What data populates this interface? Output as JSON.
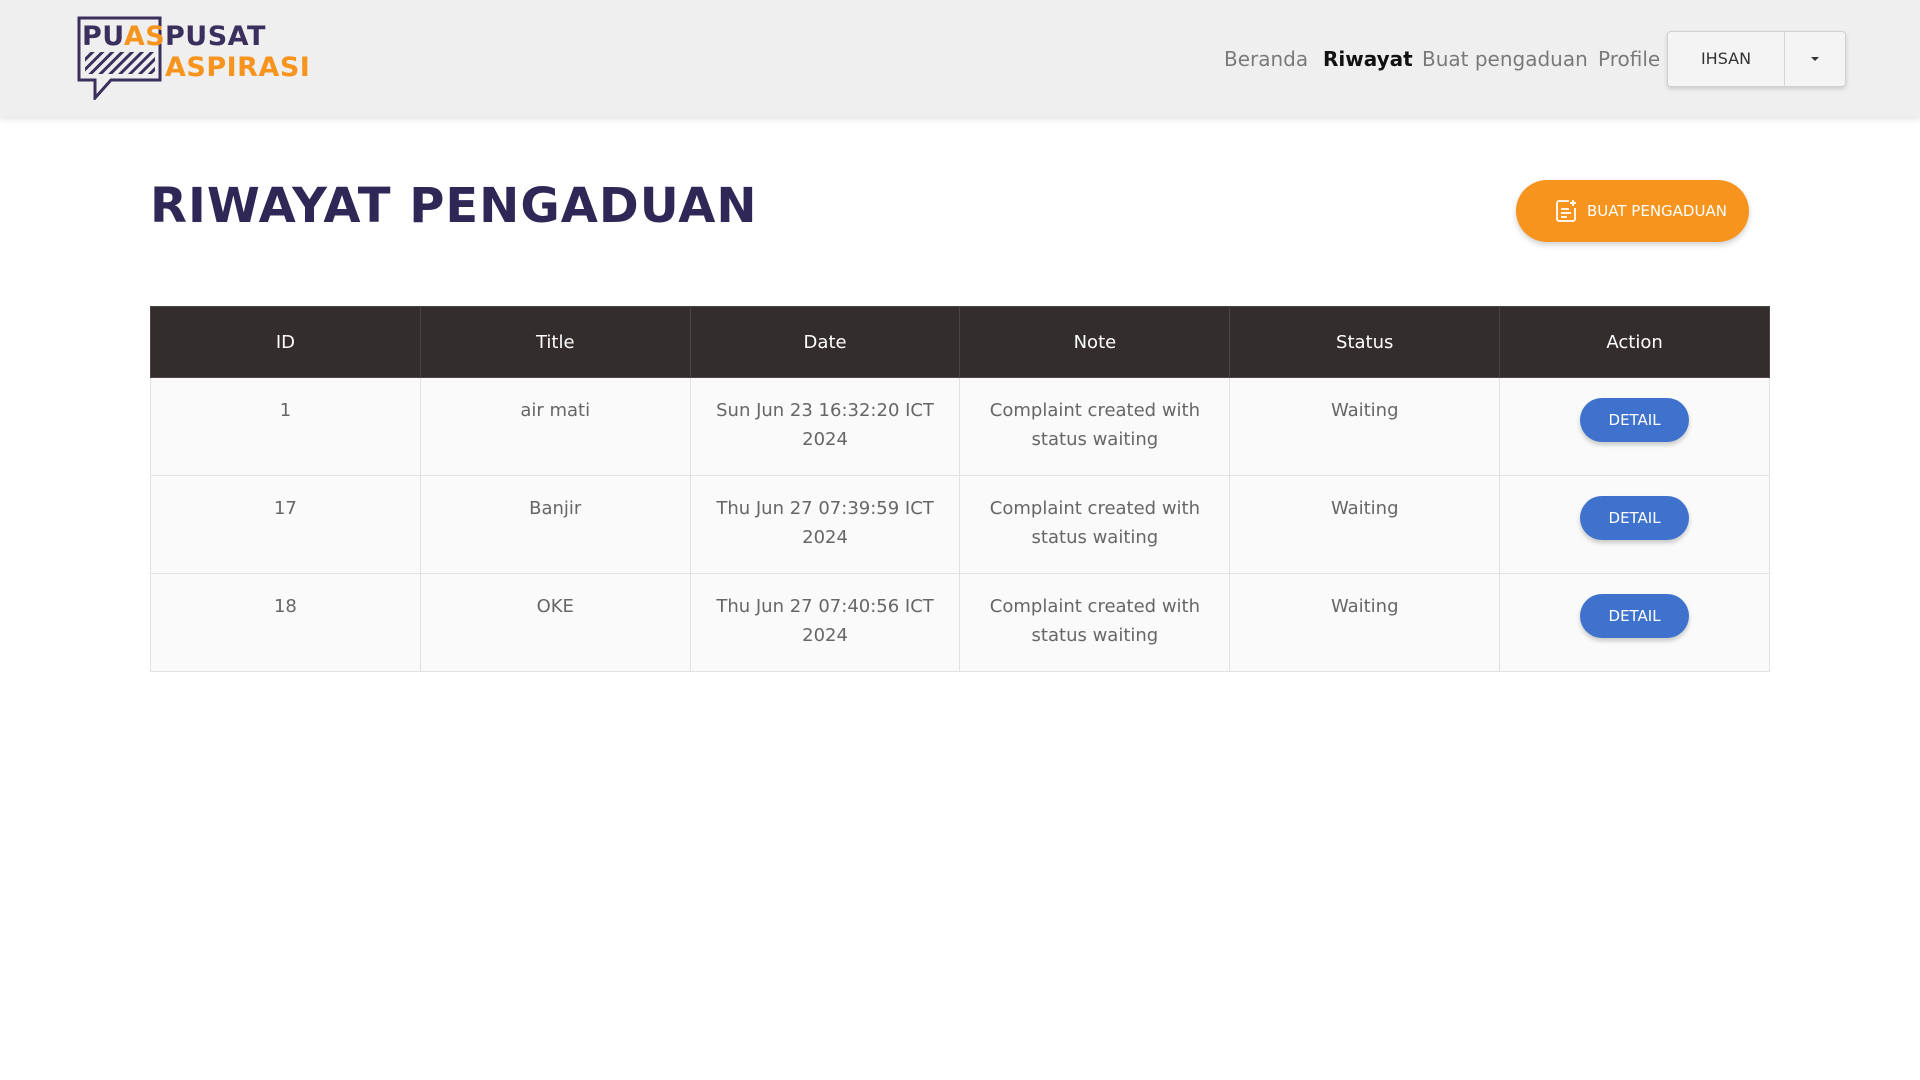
{
  "logo": {
    "puas_part1": "PU",
    "puas_part2": "AS",
    "line1": "PUSAT",
    "line2": "ASPIRASI"
  },
  "nav": {
    "links": [
      {
        "label": "Beranda",
        "active": false
      },
      {
        "label": "Riwayat",
        "active": true
      },
      {
        "label": "Buat pengaduan",
        "active": false
      },
      {
        "label": "Profile",
        "active": false
      }
    ],
    "user": "IHSAN"
  },
  "page": {
    "title": "RIWAYAT PENGADUAN",
    "create_button": "BUAT PENGADUAN"
  },
  "table": {
    "headers": [
      "ID",
      "Title",
      "Date",
      "Note",
      "Status",
      "Action"
    ],
    "rows": [
      {
        "id": "1",
        "title": "air mati",
        "date": "Sun Jun 23 16:32:20 ICT 2024",
        "note": "Complaint created with status waiting",
        "status": "Waiting",
        "action": "DETAIL"
      },
      {
        "id": "17",
        "title": "Banjir",
        "date": "Thu Jun 27 07:39:59 ICT 2024",
        "note": "Complaint created with status waiting",
        "status": "Waiting",
        "action": "DETAIL"
      },
      {
        "id": "18",
        "title": "OKE",
        "date": "Thu Jun 27 07:40:56 ICT 2024",
        "note": "Complaint created with status waiting",
        "status": "Waiting",
        "action": "DETAIL"
      }
    ]
  },
  "colors": {
    "brand_purple": "#3b2f5e",
    "brand_orange": "#f7941d",
    "table_header": "#332d2d",
    "detail_blue": "#3f72cd"
  },
  "icons": {
    "create": "document-add-icon",
    "dropdown": "caret-down-icon"
  }
}
